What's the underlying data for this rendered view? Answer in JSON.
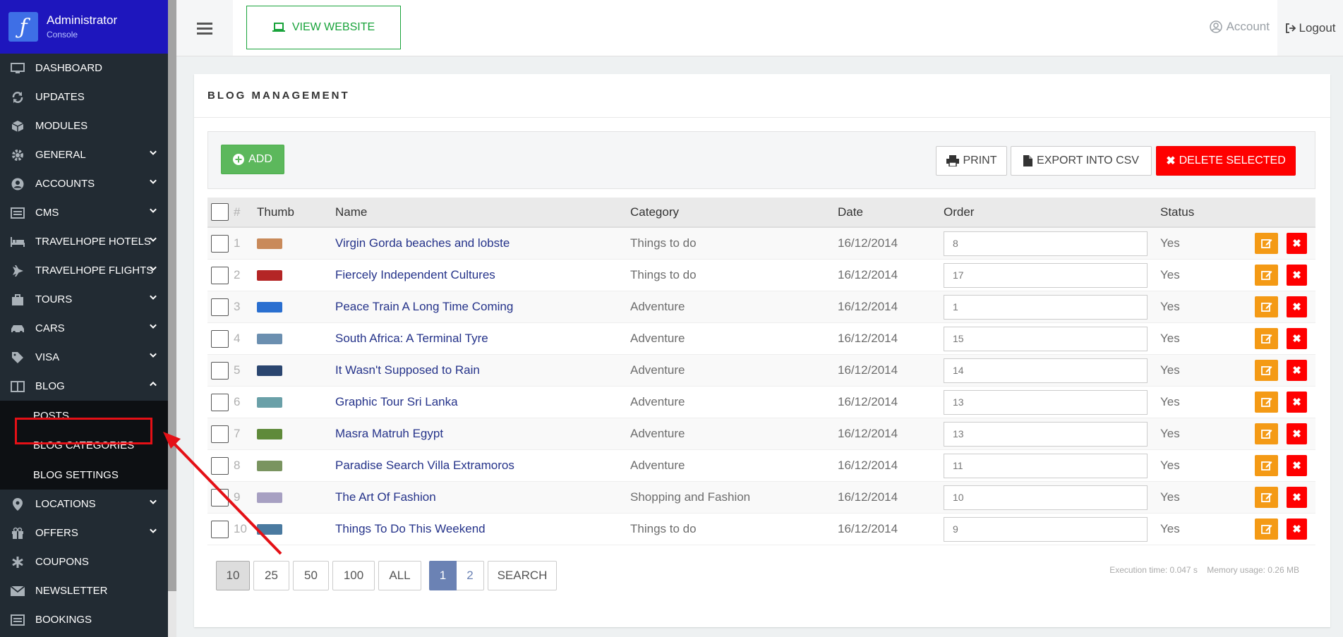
{
  "brand": {
    "title": "Administrator",
    "subtitle": "Console"
  },
  "sidebar": {
    "items": [
      {
        "label": "DASHBOARD",
        "icon": "monitor-icon",
        "chevron": ""
      },
      {
        "label": "UPDATES",
        "icon": "refresh-icon",
        "chevron": ""
      },
      {
        "label": "MODULES",
        "icon": "cube-icon",
        "chevron": ""
      },
      {
        "label": "GENERAL",
        "icon": "gear-icon",
        "chevron": "down"
      },
      {
        "label": "ACCOUNTS",
        "icon": "user-circle-icon",
        "chevron": "down"
      },
      {
        "label": "CMS",
        "icon": "list-icon",
        "chevron": "down"
      },
      {
        "label": "TRAVELHOPE HOTELS",
        "icon": "bed-icon",
        "chevron": "down"
      },
      {
        "label": "TRAVELHOPE FLIGHTS",
        "icon": "plane-icon",
        "chevron": "down"
      },
      {
        "label": "TOURS",
        "icon": "suitcase-icon",
        "chevron": "down"
      },
      {
        "label": "CARS",
        "icon": "car-icon",
        "chevron": "down"
      },
      {
        "label": "VISA",
        "icon": "tag-icon",
        "chevron": "down"
      },
      {
        "label": "BLOG",
        "icon": "book-icon",
        "chevron": "up"
      }
    ],
    "blog_sub": [
      "POSTS",
      "BLOG CATEGORIES",
      "BLOG SETTINGS"
    ],
    "items_after": [
      {
        "label": "LOCATIONS",
        "icon": "map-pin-icon",
        "chevron": "down"
      },
      {
        "label": "OFFERS",
        "icon": "gift-icon",
        "chevron": "down"
      },
      {
        "label": "COUPONS",
        "icon": "asterisk-icon",
        "chevron": ""
      },
      {
        "label": "NEWSLETTER",
        "icon": "envelope-icon",
        "chevron": ""
      },
      {
        "label": "BOOKINGS",
        "icon": "list-icon",
        "chevron": ""
      }
    ]
  },
  "topbar": {
    "view_website": "VIEW WEBSITE",
    "account": "Account",
    "logout": "Logout"
  },
  "panel": {
    "title": "BLOG MANAGEMENT",
    "add": "ADD",
    "print": "PRINT",
    "export": "EXPORT INTO CSV",
    "delete_selected": "DELETE SELECTED"
  },
  "table": {
    "headers": {
      "num": "#",
      "thumb": "Thumb",
      "name": "Name",
      "category": "Category",
      "date": "Date",
      "order": "Order",
      "status": "Status"
    },
    "rows": [
      {
        "num": "1",
        "name": "Virgin Gorda beaches and lobste",
        "category": "Things to do",
        "date": "16/12/2014",
        "order": "8",
        "status": "Yes",
        "thumb_color": "#c98a5a"
      },
      {
        "num": "2",
        "name": "Fiercely Independent Cultures",
        "category": "Things to do",
        "date": "16/12/2014",
        "order": "17",
        "status": "Yes",
        "thumb_color": "#b42525"
      },
      {
        "num": "3",
        "name": "Peace Train A Long Time Coming",
        "category": "Adventure",
        "date": "16/12/2014",
        "order": "1",
        "status": "Yes",
        "thumb_color": "#2a6fd0"
      },
      {
        "num": "4",
        "name": "South Africa: A Terminal Tyre",
        "category": "Adventure",
        "date": "16/12/2014",
        "order": "15",
        "status": "Yes",
        "thumb_color": "#6b8fb0"
      },
      {
        "num": "5",
        "name": "It Wasn't Supposed to Rain",
        "category": "Adventure",
        "date": "16/12/2014",
        "order": "14",
        "status": "Yes",
        "thumb_color": "#2b4670"
      },
      {
        "num": "6",
        "name": "Graphic Tour Sri Lanka",
        "category": "Adventure",
        "date": "16/12/2014",
        "order": "13",
        "status": "Yes",
        "thumb_color": "#6aa0a8"
      },
      {
        "num": "7",
        "name": "Masra Matruh Egypt",
        "category": "Adventure",
        "date": "16/12/2014",
        "order": "13",
        "status": "Yes",
        "thumb_color": "#5f8a3a"
      },
      {
        "num": "8",
        "name": "Paradise Search Villa Extramoros",
        "category": "Adventure",
        "date": "16/12/2014",
        "order": "11",
        "status": "Yes",
        "thumb_color": "#7a9460"
      },
      {
        "num": "9",
        "name": "The Art Of Fashion",
        "category": "Shopping and Fashion",
        "date": "16/12/2014",
        "order": "10",
        "status": "Yes",
        "thumb_color": "#a7a0c2"
      },
      {
        "num": "10",
        "name": "Things To Do This Weekend",
        "category": "Things to do",
        "date": "16/12/2014",
        "order": "9",
        "status": "Yes",
        "thumb_color": "#4a7aa0"
      }
    ]
  },
  "pagination": {
    "sizes": [
      "10",
      "25",
      "50",
      "100",
      "ALL"
    ],
    "pages": [
      "1",
      "2"
    ],
    "search": "SEARCH",
    "exec_time": "Execution time: 0.047 s",
    "memory": "Memory usage: 0.26 MB"
  },
  "colors": {
    "sidebar": "#222b33",
    "brand": "#1e16bd",
    "accent_green": "#5cb85c",
    "danger": "#ff0000",
    "warning": "#f49a15",
    "link": "#25338a"
  }
}
